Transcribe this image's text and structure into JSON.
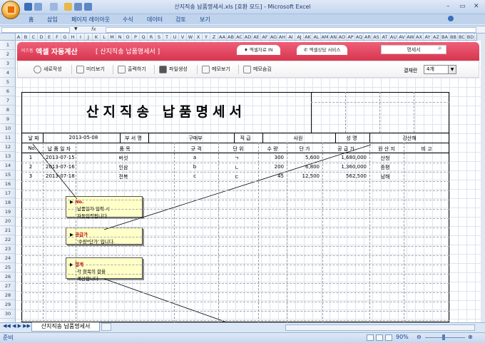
{
  "window": {
    "title": "산지직송 납품명세서.xls  [호환 모드]  -  Microsoft Excel",
    "controls": [
      "–",
      "▭",
      "✕"
    ]
  },
  "ribbon": {
    "tabs": [
      "홈",
      "삽입",
      "페이지 레이아웃",
      "수식",
      "데이터",
      "검토",
      "보기"
    ]
  },
  "formula_bar": {
    "name_box": "",
    "fx": "fx",
    "content": ""
  },
  "columns": [
    "A",
    "B",
    "C",
    "D",
    "E",
    "F",
    "G",
    "H",
    "I",
    "J",
    "K",
    "L",
    "M",
    "N",
    "O",
    "P",
    "Q",
    "R",
    "S",
    "T",
    "U",
    "V",
    "W",
    "X",
    "Y",
    "Z",
    "AA",
    "AB",
    "AC",
    "AD",
    "AE",
    "AF",
    "AG",
    "AH",
    "AI",
    "AJ",
    "AK",
    "AL",
    "AM",
    "AN",
    "AO",
    "AP",
    "AQ",
    "AR",
    "AS",
    "AT",
    "AU",
    "AV",
    "AW",
    "AX",
    "AY",
    "AZ",
    "BA",
    "BB",
    "BC",
    "BD",
    "BE"
  ],
  "rows": [
    "1",
    "2",
    "3",
    "4",
    "5",
    "6",
    "7",
    "8",
    "9",
    "10",
    "11",
    "12",
    "13",
    "14",
    "15",
    "16",
    "17",
    "18",
    "19",
    "20",
    "21",
    "22",
    "23",
    "24",
    "25",
    "26",
    "27",
    "28",
    "29",
    "30"
  ],
  "addin": {
    "brand_small": "비즈폼",
    "brand": "엑셀 자동계산",
    "subtitle": "[ 산지직송 납품명세서 ]",
    "tabs": [
      "엑셀자료 IN",
      "엑셀상담 서비스"
    ],
    "search_value": "명세서",
    "toolbar": [
      "새로작성",
      "미리보기",
      "출력하기",
      "파일생성",
      "메모보기",
      "메모숨김"
    ],
    "count_label": "결재란",
    "count_value": "4개"
  },
  "form": {
    "title": "산지직송 납품명세서",
    "date_label": "날  짜",
    "date_value": "2013-05-08",
    "dept_label": "부 서 명",
    "dept_value": "구매부",
    "position_label": "직  급",
    "position_value": "사원",
    "name_label": "성  명",
    "name_value": "강산해",
    "headers": [
      "No.",
      "납 품 일 자",
      "품          목",
      "규  격",
      "단  위",
      "수  량",
      "단     가",
      "공 급 가",
      "원 산 지",
      "비   고"
    ],
    "items": [
      [
        "1",
        "2013-07-15",
        "버섯",
        "a",
        "ㄱ",
        "300",
        "5,600",
        "1,680,000",
        "산청",
        ""
      ],
      [
        "2",
        "2013-07-16",
        "인삼",
        "b",
        "ㄴ",
        "200",
        "6,800",
        "1,360,000",
        "증평",
        ""
      ],
      [
        "3",
        "2013-07-18",
        "전복",
        "c",
        "ㄷ",
        "45",
        "12,500",
        "562,500",
        "남해",
        ""
      ]
    ]
  },
  "callouts": [
    {
      "title": "No.",
      "lines": [
        "납품일자 입력 시",
        "자동입력됩니다."
      ]
    },
    {
      "title": "공급가",
      "lines": [
        "'수량*단가' 입니다."
      ]
    },
    {
      "title": "합계",
      "lines": [
        "각 항목의 합을",
        "계산합니다."
      ]
    }
  ],
  "sheet_tab": "산지직송 납품명세서",
  "status": {
    "ready": "준비",
    "zoom": "90%"
  }
}
